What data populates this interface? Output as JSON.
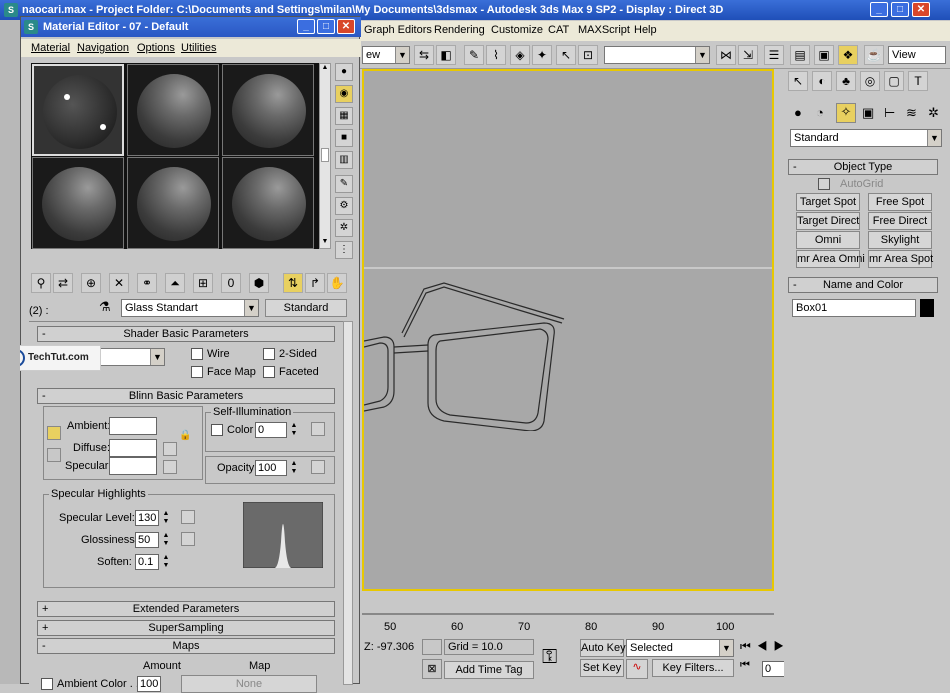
{
  "app": {
    "title": "naocari.max - Project Folder: C:\\Documents and Settings\\milan\\My Documents\\3dsmax - Autodesk 3ds Max 9 SP2 - Display : Direct 3D"
  },
  "menu": [
    "Graph Editors",
    "Rendering",
    "Customize",
    "CAT",
    "MAXScript",
    "Help"
  ],
  "toolbar": {
    "selset": "ew",
    "view": "View"
  },
  "command_panel": {
    "dropdown": "Standard",
    "object_type_header": "Object Type",
    "autogrid": "AutoGrid",
    "buttons": [
      "Target Spot",
      "Free Spot",
      "Target Direct",
      "Free Direct",
      "Omni",
      "Skylight",
      "mr Area Omni",
      "mr Area Spot"
    ],
    "name_color_header": "Name and Color",
    "name_value": "Box01",
    "name_color": "#000000"
  },
  "material_editor": {
    "title": "Material Editor - 07 - Default",
    "menu": [
      "Material",
      "Navigation",
      "Options",
      "Utilities"
    ],
    "slot_label": "(2) :",
    "material_name": "Glass Standart",
    "material_type": "Standard",
    "watermark": "TechTut.com",
    "shader": {
      "header": "Shader Basic Parameters",
      "wire": "Wire",
      "two_sided": "2-Sided",
      "face_map": "Face Map",
      "faceted": "Faceted"
    },
    "blinn": {
      "header": "Blinn Basic Parameters",
      "self_illum": "Self-Illumination",
      "ambient": "Ambient:",
      "diffuse": "Diffuse:",
      "specular": "Specular:",
      "color": "Color",
      "color_value": "0",
      "opacity": "Opacity:",
      "opacity_value": "100"
    },
    "highlights": {
      "header": "Specular Highlights",
      "level_label": "Specular Level:",
      "level": "130",
      "gloss_label": "Glossiness:",
      "gloss": "50",
      "soften_label": "Soften:",
      "soften": "0.1"
    },
    "rollouts": {
      "extended": "Extended Parameters",
      "supersampling": "SuperSampling",
      "maps": "Maps"
    },
    "maps": {
      "amount": "Amount",
      "map": "Map",
      "ambient_label": "Ambient Color . . .",
      "ambient_amount": "100",
      "none": "None"
    }
  },
  "timeline": {
    "ticks": [
      "50",
      "60",
      "70",
      "80",
      "90",
      "100"
    ]
  },
  "status": {
    "z": "Z: -97.306",
    "grid": "Grid = 10.0",
    "add_time_tag": "Add Time Tag",
    "auto_key": "Auto Key",
    "set_key": "Set Key",
    "selected": "Selected",
    "key_filters": "Key Filters...",
    "frame": "0"
  }
}
